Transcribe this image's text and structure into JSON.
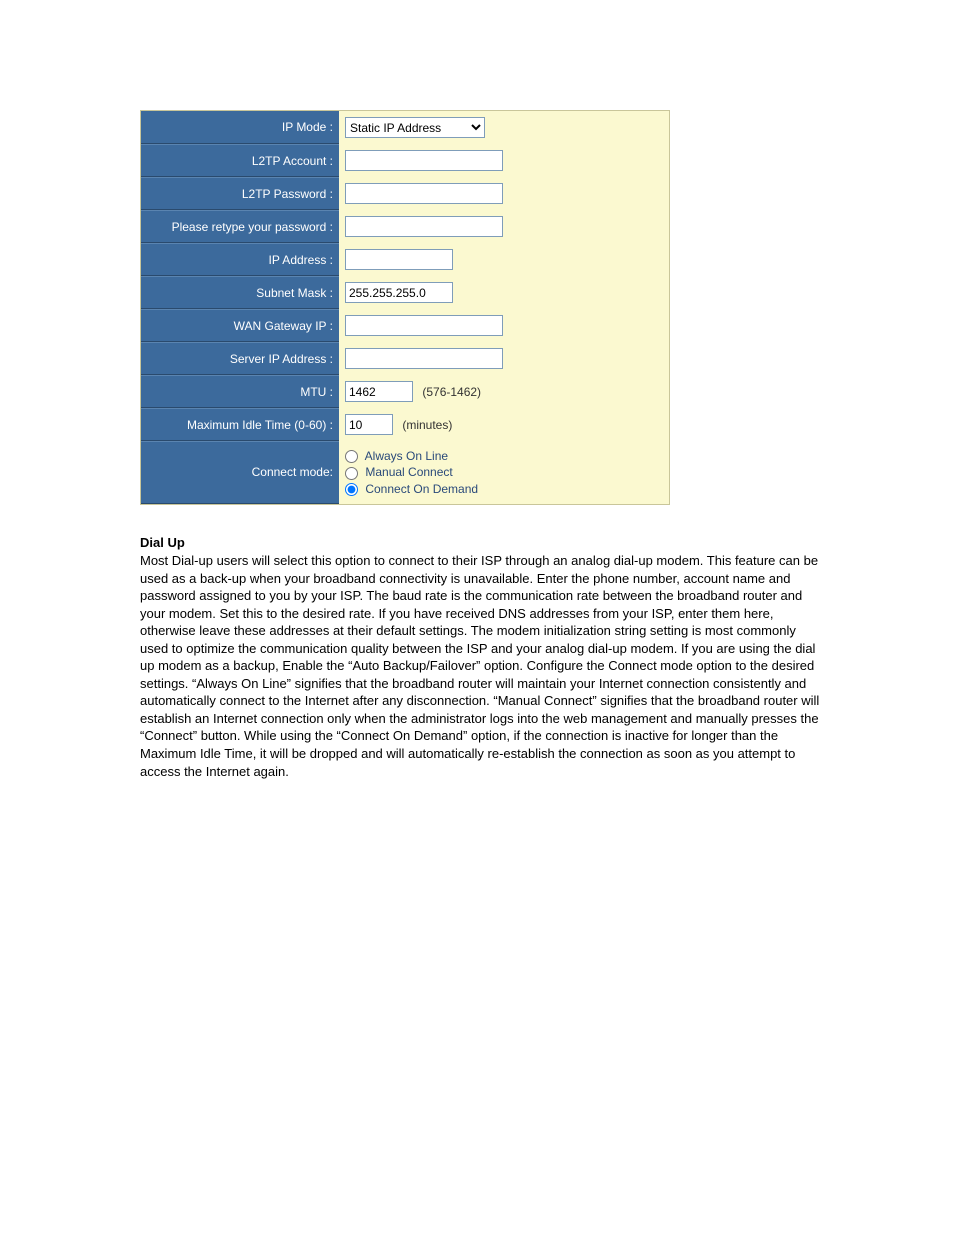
{
  "form": {
    "ip_mode": {
      "label": "IP Mode :",
      "value": "Static IP Address"
    },
    "l2tp_account": {
      "label": "L2TP Account :",
      "value": ""
    },
    "l2tp_password": {
      "label": "L2TP Password :",
      "value": ""
    },
    "retype_password": {
      "label": "Please retype your password :",
      "value": ""
    },
    "ip_address": {
      "label": "IP Address :",
      "value": ""
    },
    "subnet_mask": {
      "label": "Subnet Mask :",
      "value": "255.255.255.0"
    },
    "wan_gateway_ip": {
      "label": "WAN Gateway IP :",
      "value": ""
    },
    "server_ip_address": {
      "label": "Server IP Address :",
      "value": ""
    },
    "mtu": {
      "label": "MTU :",
      "value": "1462",
      "hint": "(576-1462)"
    },
    "max_idle": {
      "label": "Maximum Idle Time (0-60) :",
      "value": "10",
      "hint": "(minutes)"
    },
    "connect_mode": {
      "label": "Connect mode:",
      "options": {
        "always": "Always On Line",
        "manual": "Manual Connect",
        "demand": "Connect On Demand"
      },
      "selected": "demand"
    }
  },
  "doc": {
    "heading": "Dial Up",
    "body": "Most Dial-up users will select this option to connect to their ISP through an analog dial-up modem. This feature can be used as a back-up when your broadband connectivity is unavailable. Enter the phone number, account name and password assigned to you by your ISP. The baud rate is the communication rate between the broadband router and your modem. Set this to the desired rate. If you have received DNS addresses from your ISP, enter them here, otherwise leave these addresses at their default settings. The modem initialization string setting is most commonly used to optimize the communication quality between the ISP and your analog dial-up modem. If you are using the dial up modem as a backup, Enable the “Auto Backup/Failover” option. Configure the Connect mode option to the desired settings. “Always On Line” signifies that the broadband router will maintain your Internet connection consistently and automatically connect to the Internet after any disconnection. “Manual Connect” signifies that the broadband router will establish an Internet connection only when the administrator logs into the web management and manually presses the “Connect” button. While using the “Connect On Demand” option, if the connection is inactive for longer than the Maximum Idle Time, it will be dropped and will automatically re-establish the connection as soon as you attempt to access the Internet again."
  }
}
